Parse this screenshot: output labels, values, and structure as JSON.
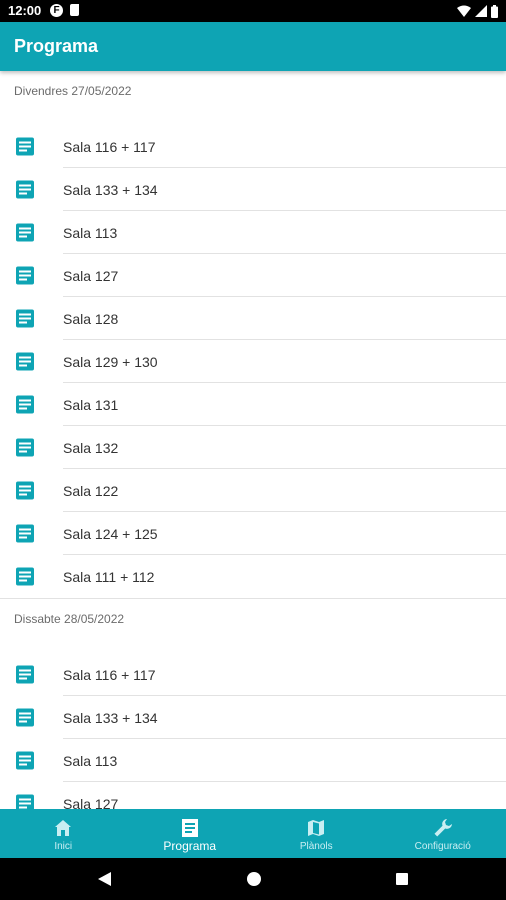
{
  "status_bar": {
    "time": "12:00",
    "f_icon_letter": "F"
  },
  "app_bar": {
    "title": "Programa"
  },
  "sections": [
    {
      "date": "Divendres 27/05/2022",
      "rooms": [
        "Sala 116 + 117",
        "Sala 133 + 134",
        "Sala 113",
        "Sala 127",
        "Sala 128",
        "Sala 129 + 130",
        "Sala 131",
        "Sala 132",
        "Sala 122",
        "Sala 124 + 125",
        "Sala 111 + 112"
      ]
    },
    {
      "date": "Dissabte 28/05/2022",
      "rooms": [
        "Sala 116 + 117",
        "Sala 133 + 134",
        "Sala 113",
        "Sala 127"
      ]
    }
  ],
  "bottom_nav": [
    {
      "label": "Inici",
      "icon": "home-icon",
      "active": false
    },
    {
      "label": "Programa",
      "icon": "document-icon",
      "active": true
    },
    {
      "label": "Plànols",
      "icon": "map-icon",
      "active": false
    },
    {
      "label": "Configuració",
      "icon": "wrench-icon",
      "active": false
    }
  ],
  "colors": {
    "accent": "#0ea4b4",
    "icon": "#0ea4b4"
  }
}
